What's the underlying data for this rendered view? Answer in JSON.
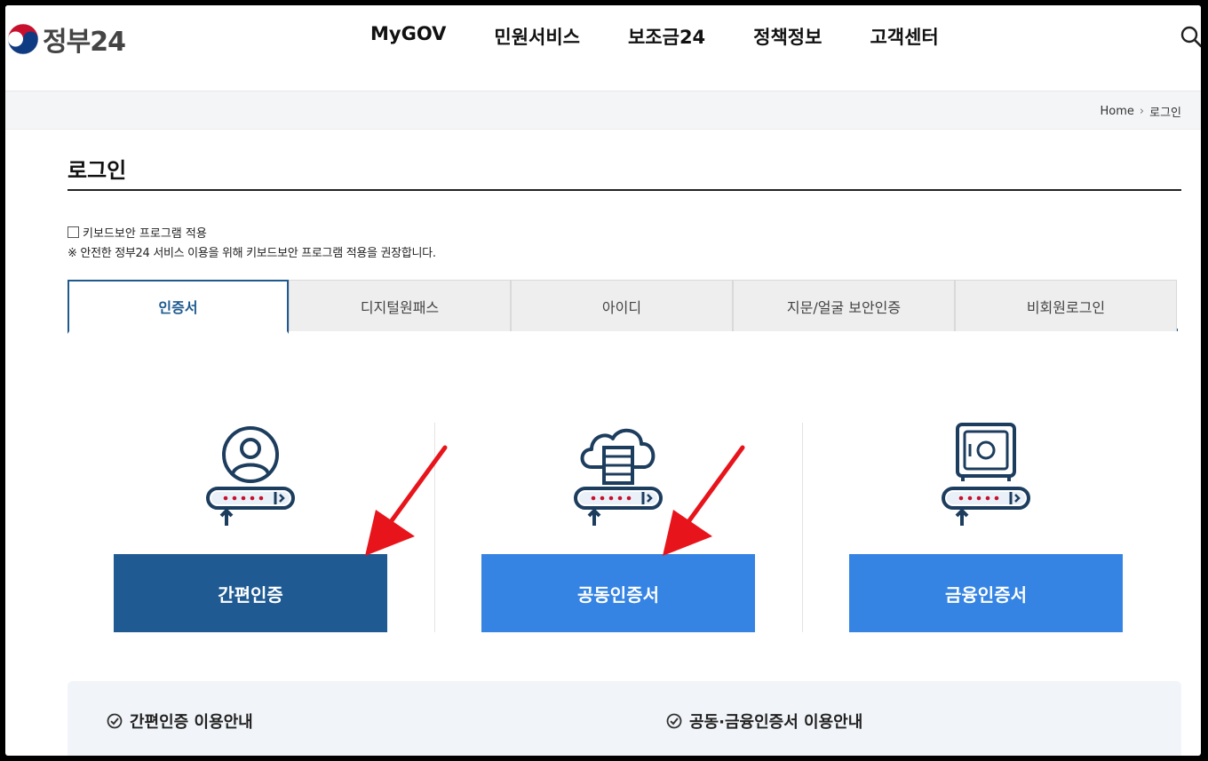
{
  "header": {
    "logo_text": "정부24",
    "nav": [
      "MyGOV",
      "민원서비스",
      "보조금24",
      "정책정보",
      "고객센터"
    ],
    "search_icon": "search-icon"
  },
  "breadcrumb": {
    "home": "Home",
    "current": "로그인"
  },
  "page_title": "로그인",
  "keyboard_security": {
    "label": "키보드보안 프로그램 적용",
    "checked": false,
    "note": "※ 안전한 정부24 서비스 이용을 위해 키보드보안 프로그램 적용을 권장합니다."
  },
  "tabs": [
    {
      "label": "인증서",
      "active": true
    },
    {
      "label": "디지털원패스",
      "active": false
    },
    {
      "label": "아이디",
      "active": false
    },
    {
      "label": "지문/얼굴 보안인증",
      "active": false
    },
    {
      "label": "비회원로그인",
      "active": false
    }
  ],
  "login_options": [
    {
      "label": "간편인증",
      "icon": "person-password-icon",
      "color": "#1f5a93"
    },
    {
      "label": "공동인증서",
      "icon": "cloud-server-password-icon",
      "color": "#3584e4"
    },
    {
      "label": "금융인증서",
      "icon": "safe-password-icon",
      "color": "#3584e4"
    }
  ],
  "info": {
    "simple_auth_guide": "간편인증 이용안내",
    "cert_guide": "공동·금융인증서 이용안내"
  },
  "colors": {
    "primary_dark": "#1f5a93",
    "primary_light": "#3584e4",
    "annotation_arrow": "#e8141b"
  }
}
